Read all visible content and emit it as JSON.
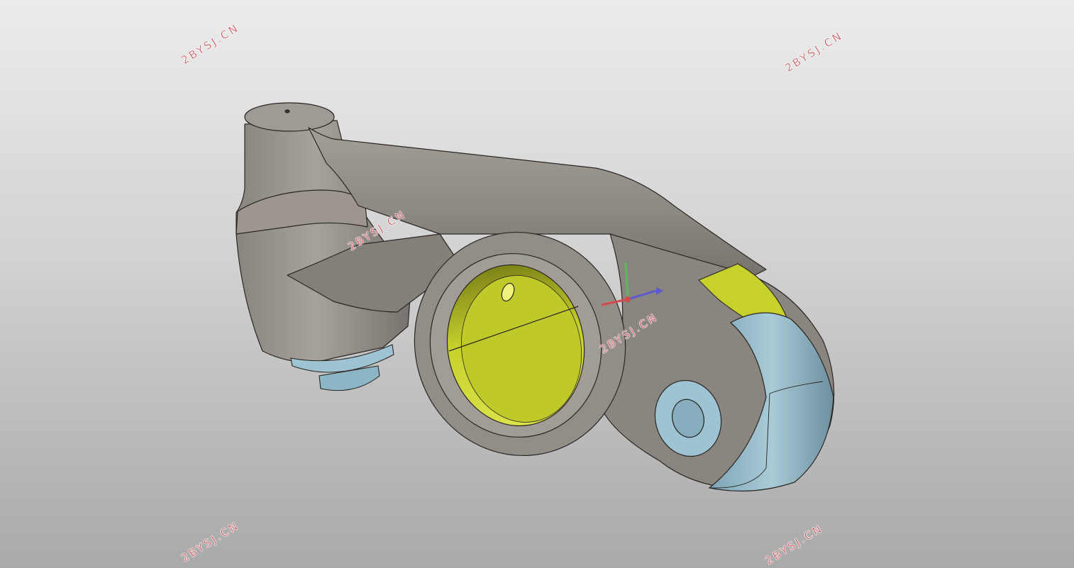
{
  "viewport": {
    "background_top": "#ececec",
    "background_bottom": "#a9a9a9"
  },
  "model": {
    "body_color": "#8e8882",
    "bushing_color": "#c6d12c",
    "pin_color": "#99bfcf",
    "edge_color": "#2a2624"
  },
  "triad": {
    "x_color": "#d24a4a",
    "y_color": "#5cb85c",
    "z_color": "#5a5ad2"
  },
  "watermarks": [
    "2BYSJ.CN",
    "2BYSJ.CN",
    "2BYSJ.CN",
    "2BYSJ.CN",
    "2BYSJ.CN",
    "2BYSJ.CN"
  ]
}
